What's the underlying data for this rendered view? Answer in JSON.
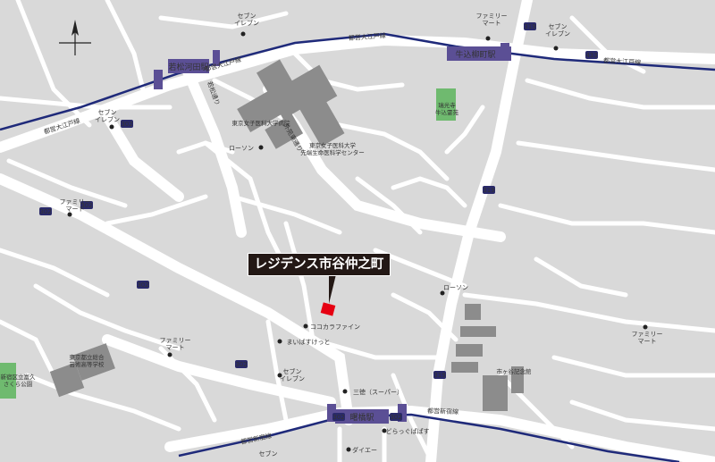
{
  "property": {
    "name": "レジデンス市谷仲之町",
    "marker_color": "#e60012"
  },
  "stations": {
    "wakamatsu_kawada": "若松河田駅",
    "ushigome_yanagicho": "牛込柳町駅",
    "akebonobashi": "曙橋駅"
  },
  "lines": {
    "oedo_1": "都営大江戸線",
    "oedo_2": "都営大江戸線",
    "oedo_3": "都営大江戸線",
    "oedo_4": "都営大江戸線",
    "shinjuku_1": "都営新宿線",
    "shinjuku_2": "都営新宿線"
  },
  "roads": {
    "r319_a": "319",
    "r319_b": "319",
    "r319_c": "319",
    "r433": "433",
    "r302_a": "302",
    "r302_b": "302",
    "r302_c": "302",
    "r302_d": "302",
    "r302_e": "302",
    "r302_f": "302",
    "r302_g": "302",
    "wakamatsu_dori": "若松通り",
    "hoshi_dori": "外苑東通り"
  },
  "poi": {
    "seven_1": "セブン\nイレブン",
    "seven_2": "セブン\nイレブン",
    "seven_3": "セブン\nイレブン",
    "seven_4": "セブン\nイレブン",
    "seven_5": "セブン\nイレブン",
    "family_1": "ファミリー\nマート",
    "family_2": "ファミリー\nマート",
    "family_3": "ファミリー\nマート",
    "family_4": "ファミリー\nマート",
    "lawson_1": "ローソン",
    "lawson_2": "ローソン",
    "twmu_hospital": "東京女子医科大学病院",
    "twmu_center": "東京女子医科大学\n先端生命医科学センター",
    "zuikoji": "瑞光寺\n牛込霊苑",
    "cocokara": "ココカラファイン",
    "maibasket": "まいばすけっと",
    "sanhashi": "三徳（スーパー）",
    "daiei": "ダイエー",
    "dora": "どらっぐぱぱす",
    "ichigaya_park": "市ヶ谷記念館",
    "school": "東京都立総合\n芸術高等学校",
    "park": "新宿区立富久\nさくら公園"
  },
  "colors": {
    "rail": "#1f2a7a",
    "road": "#ffffff",
    "ground": "#d9d9d9",
    "building": "#8c8c8c",
    "green": "#6fba6f",
    "station": "#5b4f95"
  }
}
